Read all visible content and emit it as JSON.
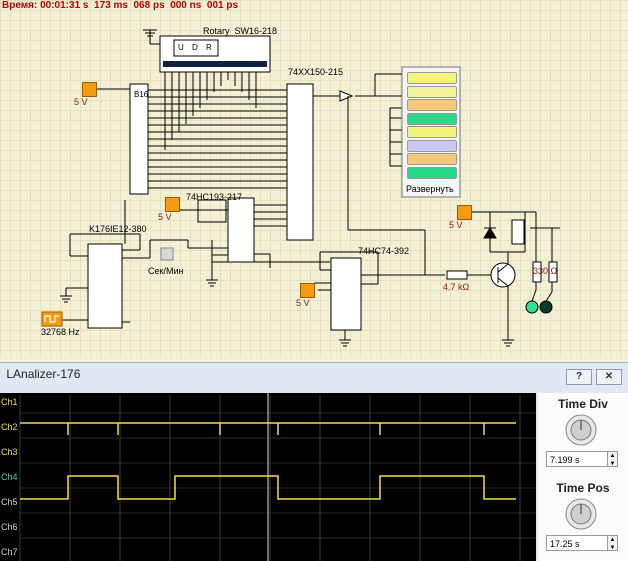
{
  "status_bar": {
    "time_text": "Время: 00:01:31 s  173 ms  068 ps  000 ns  001 ps"
  },
  "components": {
    "rotary": "Rotary_SW16-218",
    "rotary_letters": [
      "U",
      "D",
      "R"
    ],
    "mux": "74XX150-215",
    "counter": "74HC193-217",
    "osc": "K176IE12-380",
    "flipflop": "74HC74-392",
    "freq": "32768 Hz",
    "switch": "Сек/Мин",
    "resistor1": "4.7 kΩ",
    "resistor2": "330 Ω",
    "display_button": "Развернуть",
    "v5": "5 V",
    "chip_b16": "В16"
  },
  "display_bars": [
    {
      "color": "#f3f37a"
    },
    {
      "color": "#f2f29a"
    },
    {
      "color": "#f8c87a"
    },
    {
      "color": "#26d98a"
    },
    {
      "color": "#f3f37a"
    },
    {
      "color": "#c9c9ef"
    },
    {
      "color": "#f8c87a"
    },
    {
      "color": "#26d98a"
    }
  ],
  "analyzer": {
    "title": "LAnalizer-176",
    "help_button": "?",
    "close_button": "✕",
    "channels": [
      {
        "name": "Ch1",
        "color": "#f0e040"
      },
      {
        "name": "Ch2",
        "color": "#f0e040"
      },
      {
        "name": "Ch3",
        "color": "#f0e040"
      },
      {
        "name": "Ch4",
        "color": "#3ad8a8"
      },
      {
        "name": "Ch5",
        "color": "#d0d0d0"
      },
      {
        "name": "Ch6",
        "color": "#d0d0d0"
      },
      {
        "name": "Ch7",
        "color": "#d0d0d0"
      }
    ],
    "time_div_label": "Time Div",
    "time_div_value": "7.199 s",
    "time_pos_label": "Time Pos",
    "time_pos_value": "17.25 s"
  }
}
